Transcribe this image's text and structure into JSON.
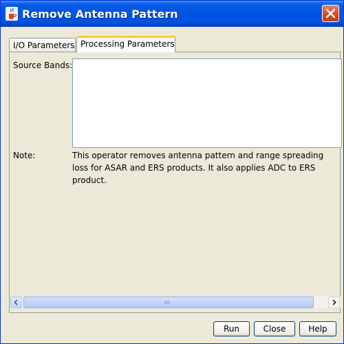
{
  "window": {
    "title": "Remove Antenna Pattern",
    "app_icon": "java-coffee-cup-icon",
    "close_icon": "close-icon"
  },
  "tabs": [
    {
      "label": "I/O Parameters",
      "selected": false
    },
    {
      "label": "Processing Parameters",
      "selected": true
    }
  ],
  "form": {
    "source_bands_label": "Source Bands:",
    "source_bands_items": [],
    "note_label": "Note:",
    "note_text": "This operator removes antenna pattern and range spreading loss for ASAR and ERS products. It also applies ADC to ERS product."
  },
  "buttons": {
    "run_label": "Run",
    "close_label": "Close",
    "help_label": "Help"
  },
  "colors": {
    "titlebar": "#0054e3",
    "close_button": "#d1471f",
    "dialog_bg": "#ece9d8",
    "selected_tab_accent": "#ffc83c"
  }
}
